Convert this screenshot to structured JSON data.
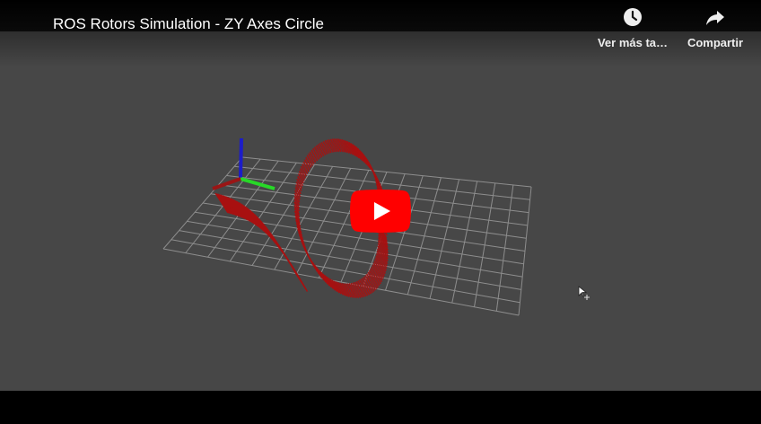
{
  "player": {
    "title": "ROS Rotors Simulation - ZY Axes Circle",
    "actions": [
      {
        "label": "Ver más ta…",
        "icon": "clock-icon"
      },
      {
        "label": "Compartir",
        "icon": "share-arrow-icon"
      }
    ],
    "play_icon": "youtube-play-icon"
  },
  "colors": {
    "viewport_background": "#474747",
    "grid": "#a0a0a0",
    "trajectory": "#b01010",
    "axis_x": "#a01515",
    "axis_y": "#22dd22",
    "axis_z": "#1a1ad0",
    "play_button": "#ff0000"
  }
}
